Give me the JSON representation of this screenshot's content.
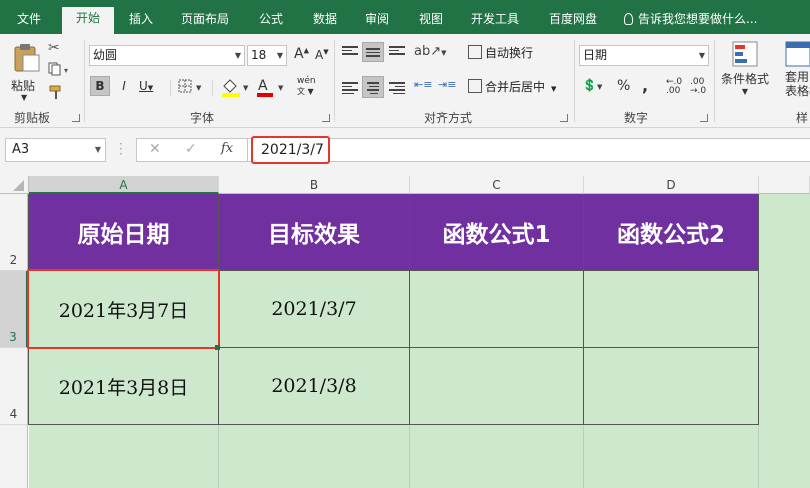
{
  "menu": {
    "tabs": [
      "文件",
      "开始",
      "插入",
      "页面布局",
      "公式",
      "数据",
      "审阅",
      "视图",
      "开发工具",
      "百度网盘"
    ],
    "active_tab": "开始",
    "tell_me": "告诉我您想要做什么..."
  },
  "ribbon": {
    "clipboard": {
      "paste": "粘贴",
      "label": "剪贴板"
    },
    "font": {
      "name": "幼圆",
      "size": "18",
      "bold": "B",
      "italic": "I",
      "underline": "U",
      "label": "字体",
      "phonetic": "wén"
    },
    "alignment": {
      "wrap": "自动换行",
      "merge": "合并后居中",
      "label": "对齐方式"
    },
    "number": {
      "format": "日期",
      "percent": "%",
      "comma": ",",
      "label": "数字"
    },
    "styles": {
      "conditional": "条件格式",
      "table": "套用\n表格格",
      "label": "样"
    }
  },
  "formula_bar": {
    "name_box": "A3",
    "cancel": "✕",
    "enter": "✓",
    "fx": "fx",
    "value": "2021/3/7"
  },
  "sheet": {
    "columns": [
      "A",
      "B",
      "C",
      "D"
    ],
    "rows": [
      "2",
      "3",
      "4"
    ],
    "header_row": [
      "原始日期",
      "目标效果",
      "函数公式1",
      "函数公式2"
    ],
    "data": [
      [
        "2021年3月7日",
        "2021/3/7",
        "",
        ""
      ],
      [
        "2021年3月8日",
        "2021/3/8",
        "",
        ""
      ]
    ],
    "active_cell": "A3"
  },
  "colors": {
    "excel_green": "#217346",
    "header_fill": "#7030a0",
    "data_fill": "#cde8cd",
    "highlight": "#e8352b"
  }
}
